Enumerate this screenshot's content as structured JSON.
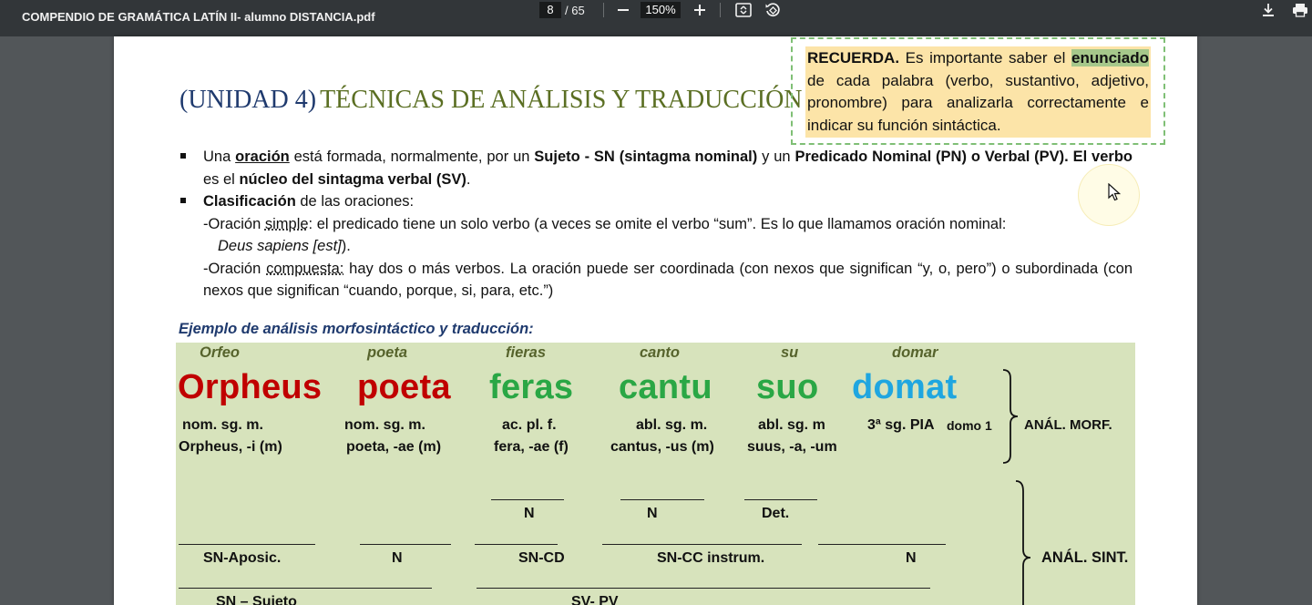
{
  "toolbar": {
    "title": "COMPENDIO DE GRAMÁTICA LATÍN II- alumno DISTANCIA.pdf",
    "page_current": "8",
    "page_total": "/ 65",
    "zoom": "150%",
    "icons": [
      "minus-icon",
      "plus-icon",
      "fit-page-icon",
      "rotate-icon",
      "download-icon",
      "print-icon"
    ]
  },
  "doc": {
    "heading_unit": "(UNIDAD 4)",
    "heading_title": "TÉCNICAS DE ANÁLISIS Y TRADUCCIÓN",
    "recuerda": {
      "title": "RECUERDA.",
      "pre": " Es importante saber el ",
      "key": "enunciado",
      "post": " de cada palabra (verbo, sustantivo, adjetivo, pronombre) para analizarla correctamente e indicar su función sintáctica."
    },
    "bullet1": {
      "a": "Una ",
      "b": "oración",
      "c": " está formada, normalmente, por un ",
      "d": "Sujeto - SN (sintagma nominal)",
      "e": " y un ",
      "f": "Predicado Nominal (PN)  o Verbal (PV).",
      "g": " ",
      "h": "El verbo",
      "i": " es el ",
      "j": "núcleo del sintagma verbal (SV)",
      "k": "."
    },
    "bullet2": {
      "a": "Clasificación",
      "b": " de las oraciones:"
    },
    "simple": {
      "a": "-Oración ",
      "b": "simple",
      "c": ": el predicado tiene un solo verbo (a veces se omite el verbo “sum”. Es lo que llamamos oración nominal:",
      "d": "Deus sapiens [est]",
      "e": ")."
    },
    "compuesta": {
      "a": "-Oración ",
      "b": "compuesta:",
      "c": " hay dos o más verbos. La oración puede ser coordinada (con nexos que significan “y, o, pero”) o subordinada (con nexos que significan “cuando, porque, si, para, etc.”)"
    },
    "example_title": "Ejemplo de análisis morfosintáctico y traducción:",
    "glosses": [
      "Orfeo",
      "poeta",
      "fieras",
      "canto",
      "su",
      "domar"
    ],
    "latin": [
      "Orpheus",
      "poeta",
      "feras",
      "cantu",
      "suo",
      "domat"
    ],
    "latin_colors": [
      "#c00000",
      "#c00000",
      "#2aa745",
      "#2aa745",
      "#2aa745",
      "#1fa6e0"
    ],
    "morf1": [
      "nom. sg. m.",
      "nom. sg. m.",
      "ac. pl. f.",
      "abl. sg. m.",
      "abl. sg.  m",
      "3ª sg. PIA"
    ],
    "morf1_extra": "domo 1",
    "morf2": [
      "Orpheus, -i (m)",
      "poeta, -ae (m)",
      "fera, -ae (f)",
      "cantus, -us (m)",
      "suus, -a, -um"
    ],
    "morf_label": "ANÁL. MORF.",
    "sint1": [
      "N",
      "N",
      "Det."
    ],
    "sint2": [
      "SN-Aposic.",
      "N",
      "SN-CD",
      "SN-CC instrum.",
      "N"
    ],
    "sint3": [
      "SN – Sujeto",
      "SV- PV"
    ],
    "sint_label": "ANÁL. SINT."
  }
}
